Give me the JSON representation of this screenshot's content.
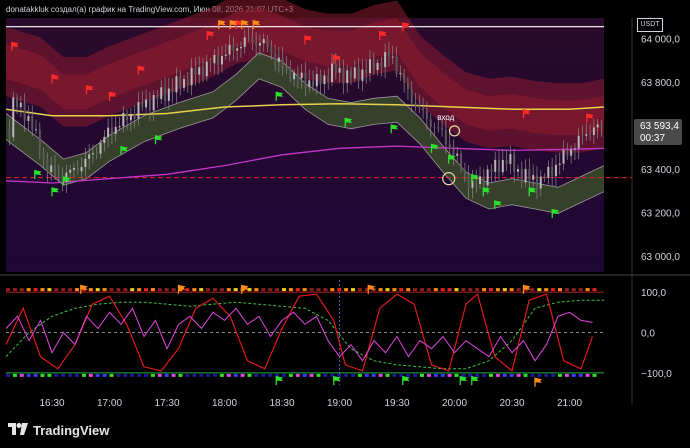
{
  "header": {
    "title": "donatakkluk создал(а) график на TradingView.com, Июн 08, 2026 21:07 UTC+3"
  },
  "currency": "USDT",
  "footer": {
    "brand": "TradingView"
  },
  "annotation": {
    "entry_label": "вход"
  },
  "price_label": {
    "price": "63 593,4",
    "countdown": "00:37",
    "value": 63593.4
  },
  "colors": {
    "background_top": "#1e0a22",
    "cloud_red": "#8b1a2e",
    "cloud_green": "#3a4a2a",
    "ma_yellow": "#e6d34a",
    "ma_magenta": "#c338c8",
    "candle": "#8a8a8a",
    "flag_red": "#ff2a2a",
    "flag_green": "#2ce02c",
    "flag_orange": "#ff8c1a",
    "osc_red": "#e01b1b",
    "osc_magenta": "#e044e0",
    "osc_green_dash": "#3fbf3f"
  },
  "chart_data": [
    {
      "type": "line",
      "title": "",
      "y_ticks": [
        "64 000,0",
        "63 800,0",
        "63 600,0",
        "63 400,0",
        "63 200,0",
        "63 000,0"
      ],
      "y_tick_values": [
        64000,
        63800,
        63600,
        63400,
        63200,
        63000
      ],
      "ylim": [
        62930,
        64100
      ],
      "x_ticks": [
        "16:30",
        "17:00",
        "17:30",
        "18:00",
        "18:30",
        "19:00",
        "19:30",
        "20:00",
        "20:30",
        "21:00"
      ],
      "x_tick_values": [
        16.5,
        17.0,
        17.5,
        18.0,
        18.5,
        19.0,
        19.5,
        20.0,
        20.5,
        21.0
      ],
      "xlim": [
        16.1,
        21.3
      ],
      "horizontal_lines": [
        {
          "name": "white",
          "value": 64060
        },
        {
          "name": "red-dashed",
          "value": 63365
        }
      ],
      "series": [
        {
          "key": "close",
          "values": [
            [
              16.15,
              63720
            ],
            [
              16.3,
              63640
            ],
            [
              16.45,
              63420
            ],
            [
              16.55,
              63360
            ],
            [
              16.7,
              63400
            ],
            [
              16.85,
              63470
            ],
            [
              17.0,
              63580
            ],
            [
              17.15,
              63640
            ],
            [
              17.3,
              63700
            ],
            [
              17.5,
              63760
            ],
            [
              17.7,
              63830
            ],
            [
              17.9,
              63900
            ],
            [
              18.05,
              63950
            ],
            [
              18.2,
              64000
            ],
            [
              18.35,
              63980
            ],
            [
              18.5,
              63880
            ],
            [
              18.65,
              63820
            ],
            [
              18.8,
              63800
            ],
            [
              18.95,
              63860
            ],
            [
              19.1,
              63830
            ],
            [
              19.3,
              63880
            ],
            [
              19.45,
              63930
            ],
            [
              19.6,
              63750
            ],
            [
              19.75,
              63640
            ],
            [
              19.9,
              63560
            ],
            [
              20.05,
              63420
            ],
            [
              20.15,
              63320
            ],
            [
              20.3,
              63390
            ],
            [
              20.45,
              63450
            ],
            [
              20.6,
              63370
            ],
            [
              20.75,
              63350
            ],
            [
              20.9,
              63430
            ],
            [
              21.05,
              63520
            ],
            [
              21.2,
              63593
            ]
          ]
        },
        {
          "key": "ma_yellow",
          "values": [
            [
              16.1,
              63680
            ],
            [
              16.5,
              63650
            ],
            [
              17.0,
              63650
            ],
            [
              17.5,
              63660
            ],
            [
              18.0,
              63690
            ],
            [
              18.5,
              63700
            ],
            [
              19.0,
              63705
            ],
            [
              19.5,
              63700
            ],
            [
              20.0,
              63690
            ],
            [
              20.5,
              63680
            ],
            [
              21.0,
              63680
            ],
            [
              21.3,
              63690
            ]
          ]
        },
        {
          "key": "ma_magenta",
          "values": [
            [
              16.1,
              63350
            ],
            [
              16.5,
              63340
            ],
            [
              17.0,
              63360
            ],
            [
              17.5,
              63380
            ],
            [
              18.0,
              63420
            ],
            [
              18.5,
              63470
            ],
            [
              19.0,
              63500
            ],
            [
              19.5,
              63510
            ],
            [
              20.0,
              63500
            ],
            [
              20.5,
              63490
            ],
            [
              21.0,
              63495
            ],
            [
              21.3,
              63500
            ]
          ]
        },
        {
          "key": "green_band_mid",
          "values": [
            [
              16.1,
              63600
            ],
            [
              16.4,
              63480
            ],
            [
              16.6,
              63390
            ],
            [
              16.8,
              63420
            ],
            [
              17.0,
              63500
            ],
            [
              17.3,
              63590
            ],
            [
              17.6,
              63650
            ],
            [
              17.9,
              63700
            ],
            [
              18.1,
              63780
            ],
            [
              18.3,
              63880
            ],
            [
              18.5,
              63840
            ],
            [
              18.7,
              63740
            ],
            [
              18.9,
              63670
            ],
            [
              19.1,
              63650
            ],
            [
              19.3,
              63670
            ],
            [
              19.5,
              63680
            ],
            [
              19.7,
              63580
            ],
            [
              19.9,
              63450
            ],
            [
              20.1,
              63330
            ],
            [
              20.3,
              63280
            ],
            [
              20.5,
              63300
            ],
            [
              20.7,
              63280
            ],
            [
              20.9,
              63260
            ],
            [
              21.1,
              63310
            ],
            [
              21.3,
              63360
            ]
          ]
        },
        {
          "key": "red_band_mid",
          "values": [
            [
              16.1,
              63900
            ],
            [
              16.4,
              63850
            ],
            [
              16.6,
              63760
            ],
            [
              16.8,
              63760
            ],
            [
              17.0,
              63810
            ],
            [
              17.3,
              63870
            ],
            [
              17.6,
              63930
            ],
            [
              17.9,
              63990
            ],
            [
              18.1,
              64050
            ],
            [
              18.3,
              64070
            ],
            [
              18.5,
              64030
            ],
            [
              18.7,
              63980
            ],
            [
              18.9,
              63960
            ],
            [
              19.1,
              63960
            ],
            [
              19.3,
              64000
            ],
            [
              19.5,
              64020
            ],
            [
              19.7,
              63860
            ],
            [
              19.9,
              63770
            ],
            [
              20.1,
              63690
            ],
            [
              20.3,
              63660
            ],
            [
              20.5,
              63670
            ],
            [
              20.7,
              63650
            ],
            [
              20.9,
              63640
            ],
            [
              21.1,
              63640
            ],
            [
              21.3,
              63660
            ]
          ]
        }
      ]
    },
    {
      "type": "line",
      "title": "",
      "y_ticks": [
        "100,0",
        "0,0",
        "−100,0"
      ],
      "y_tick_values": [
        100,
        0,
        -100
      ],
      "ylim": [
        -130,
        130
      ],
      "series": [
        {
          "key": "osc_red",
          "values": [
            [
              16.1,
              -30
            ],
            [
              16.25,
              60
            ],
            [
              16.4,
              -60
            ],
            [
              16.55,
              -90
            ],
            [
              16.7,
              -30
            ],
            [
              16.85,
              70
            ],
            [
              17.0,
              90
            ],
            [
              17.15,
              20
            ],
            [
              17.3,
              -85
            ],
            [
              17.45,
              -95
            ],
            [
              17.6,
              -40
            ],
            [
              17.75,
              60
            ],
            [
              17.9,
              85
            ],
            [
              18.05,
              40
            ],
            [
              18.2,
              -70
            ],
            [
              18.35,
              -90
            ],
            [
              18.5,
              10
            ],
            [
              18.65,
              90
            ],
            [
              18.8,
              95
            ],
            [
              18.95,
              30
            ],
            [
              19.05,
              -80
            ],
            [
              19.2,
              -95
            ],
            [
              19.35,
              60
            ],
            [
              19.5,
              95
            ],
            [
              19.65,
              70
            ],
            [
              19.8,
              -80
            ],
            [
              19.95,
              -95
            ],
            [
              20.1,
              70
            ],
            [
              20.2,
              95
            ],
            [
              20.35,
              -60
            ],
            [
              20.5,
              -95
            ],
            [
              20.65,
              80
            ],
            [
              20.8,
              95
            ],
            [
              20.95,
              -70
            ],
            [
              21.1,
              -90
            ],
            [
              21.2,
              -10
            ]
          ]
        },
        {
          "key": "osc_magenta",
          "values": [
            [
              16.1,
              10
            ],
            [
              16.2,
              40
            ],
            [
              16.3,
              -20
            ],
            [
              16.4,
              30
            ],
            [
              16.5,
              -50
            ],
            [
              16.6,
              0
            ],
            [
              16.7,
              -30
            ],
            [
              16.8,
              40
            ],
            [
              16.9,
              10
            ],
            [
              17.0,
              50
            ],
            [
              17.1,
              20
            ],
            [
              17.2,
              60
            ],
            [
              17.3,
              -10
            ],
            [
              17.4,
              30
            ],
            [
              17.5,
              -40
            ],
            [
              17.6,
              20
            ],
            [
              17.7,
              40
            ],
            [
              17.8,
              10
            ],
            [
              17.9,
              50
            ],
            [
              18.0,
              30
            ],
            [
              18.1,
              60
            ],
            [
              18.2,
              20
            ],
            [
              18.3,
              40
            ],
            [
              18.4,
              -10
            ],
            [
              18.5,
              30
            ],
            [
              18.6,
              50
            ],
            [
              18.7,
              20
            ],
            [
              18.8,
              40
            ],
            [
              18.9,
              -20
            ],
            [
              19.0,
              -60
            ],
            [
              19.1,
              -30
            ],
            [
              19.2,
              -70
            ],
            [
              19.3,
              -20
            ],
            [
              19.4,
              -50
            ],
            [
              19.5,
              -10
            ],
            [
              19.6,
              -60
            ],
            [
              19.7,
              -20
            ],
            [
              19.8,
              -40
            ],
            [
              19.9,
              -10
            ],
            [
              20.0,
              -50
            ],
            [
              20.1,
              -20
            ],
            [
              20.2,
              -40
            ],
            [
              20.3,
              -60
            ],
            [
              20.4,
              -10
            ],
            [
              20.5,
              -50
            ],
            [
              20.6,
              -20
            ],
            [
              20.7,
              -70
            ],
            [
              20.8,
              -30
            ],
            [
              20.9,
              40
            ],
            [
              21.0,
              50
            ],
            [
              21.1,
              30
            ],
            [
              21.2,
              25
            ]
          ]
        },
        {
          "key": "osc_green_dash",
          "values": [
            [
              16.1,
              -60
            ],
            [
              16.3,
              0
            ],
            [
              16.5,
              40
            ],
            [
              16.7,
              60
            ],
            [
              16.9,
              70
            ],
            [
              17.1,
              75
            ],
            [
              17.3,
              75
            ],
            [
              17.5,
              70
            ],
            [
              17.7,
              65
            ],
            [
              17.9,
              70
            ],
            [
              18.1,
              75
            ],
            [
              18.3,
              70
            ],
            [
              18.5,
              65
            ],
            [
              18.7,
              60
            ],
            [
              18.9,
              30
            ],
            [
              19.1,
              -40
            ],
            [
              19.3,
              -70
            ],
            [
              19.5,
              -80
            ],
            [
              19.7,
              -85
            ],
            [
              19.9,
              -90
            ],
            [
              20.1,
              -90
            ],
            [
              20.3,
              -70
            ],
            [
              20.5,
              -20
            ],
            [
              20.7,
              60
            ],
            [
              20.9,
              75
            ],
            [
              21.1,
              80
            ],
            [
              21.3,
              80
            ]
          ]
        }
      ]
    }
  ]
}
